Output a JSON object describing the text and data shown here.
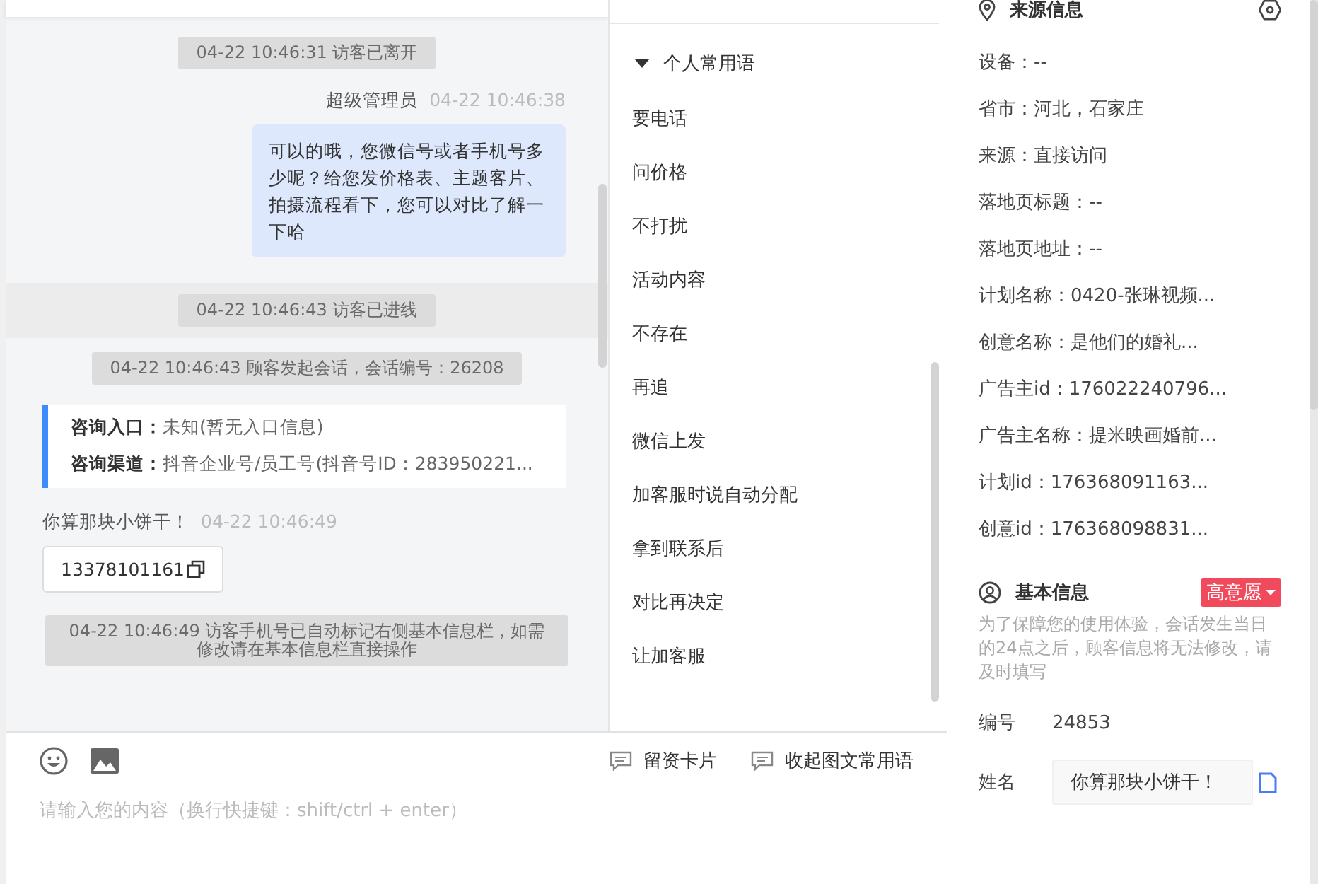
{
  "chat": {
    "messages": [
      {
        "kind": "system",
        "text": "04-22 10:46:31 访客已离开",
        "shaded": false
      },
      {
        "kind": "agent",
        "sender": "超级管理员",
        "time": "04-22 10:46:38",
        "text": "可以的哦，您微信号或者手机号多少呢？给您发价格表、主题客片、拍摄流程看下，您可以对比了解一下哈"
      },
      {
        "kind": "system",
        "text": "04-22 10:46:43 访客已进线",
        "shaded": true
      },
      {
        "kind": "system",
        "text": "04-22 10:46:43 顾客发起会话，会话编号：26208",
        "shaded": false
      },
      {
        "kind": "info",
        "lines": [
          {
            "label": "咨询入口：",
            "value": "未知(暂无入口信息)"
          },
          {
            "label": "咨询渠道：",
            "value": "抖音企业号/员工号(抖音号ID：283950221..."
          }
        ]
      },
      {
        "kind": "visitor",
        "sender": "你算那块小饼干！",
        "time": "04-22 10:46:49",
        "text": "13378101161"
      },
      {
        "kind": "system",
        "text": "04-22 10:46:49 访客手机号已自动标记右侧基本信息栏，如需修改请在基本信息栏直接操作",
        "shaded": false
      }
    ]
  },
  "quick_replies": {
    "group": {
      "label": "个人常用语",
      "expanded": true
    },
    "items": [
      "要电话",
      "问价格",
      "不打扰",
      "活动内容",
      "不存在",
      "再追",
      "微信上发",
      "加客服时说自动分配",
      "拿到联系后",
      "对比再决定",
      "让加客服"
    ]
  },
  "composer": {
    "actions": [
      "留资卡片",
      "收起图文常用语"
    ],
    "placeholder": "请输入您的内容（换行快捷键：shift/ctrl + enter）"
  },
  "source_info": {
    "title": "来源信息",
    "fields": [
      "设备：--",
      "省市：河北，石家庄",
      "来源：直接访问",
      "落地页标题：--",
      "落地页地址：--",
      "计划名称：0420-张琳视频...",
      "创意名称：是他们的婚礼...",
      "广告主id：176022240796...",
      "广告主名称：提米映画婚前...",
      "计划id：176368091163...",
      "创意id：176368098831..."
    ]
  },
  "basic_info": {
    "title": "基本信息",
    "intent": "高意愿",
    "notice": "为了保障您的使用体验，会话发生当日的24点之后，顾客信息将无法修改，请及时填写",
    "fields": [
      {
        "kind": "text",
        "label": "编号",
        "value": "24853"
      },
      {
        "kind": "input",
        "label": "姓名",
        "value": "你算那块小饼干！"
      }
    ]
  }
}
